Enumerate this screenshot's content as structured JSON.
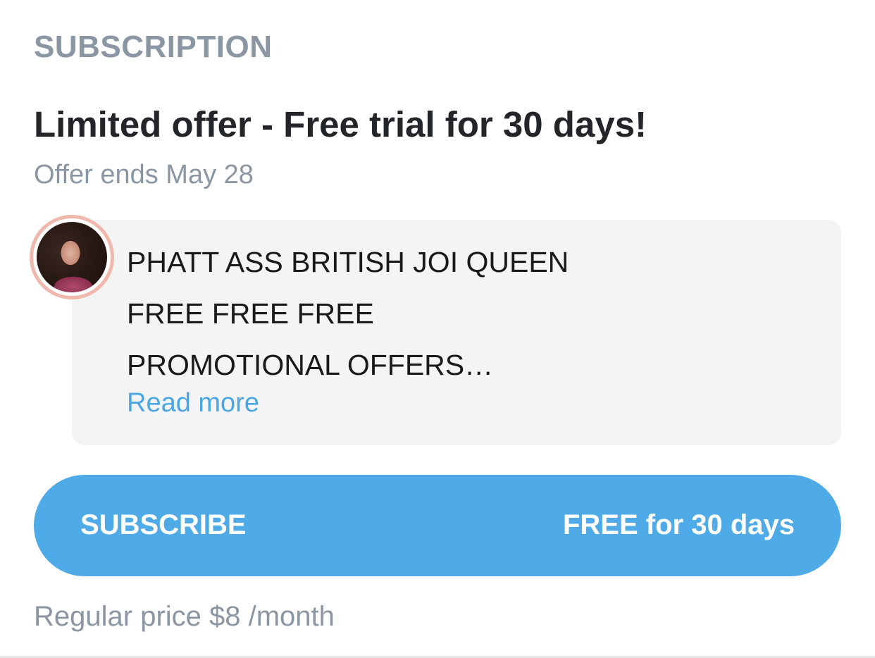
{
  "section": {
    "label": "SUBSCRIPTION"
  },
  "offer": {
    "title": "Limited offer - Free trial for 30 days!",
    "ends": "Offer ends May 28"
  },
  "promo": {
    "lines": [
      "PHATT ASS BRITISH JOI QUEEN",
      "FREE FREE FREE",
      "PROMOTIONAL OFFERS…"
    ],
    "read_more": "Read more"
  },
  "subscribe_button": {
    "label": "SUBSCRIBE",
    "price": "FREE for 30 days"
  },
  "regular_price": "Regular price $8 /month",
  "colors": {
    "accent": "#4fabe7",
    "link": "#4aa7e6",
    "muted": "#8a96a3",
    "title": "#242529",
    "card_bg": "#f4f4f4",
    "avatar_ring": "#f0b8ad"
  }
}
